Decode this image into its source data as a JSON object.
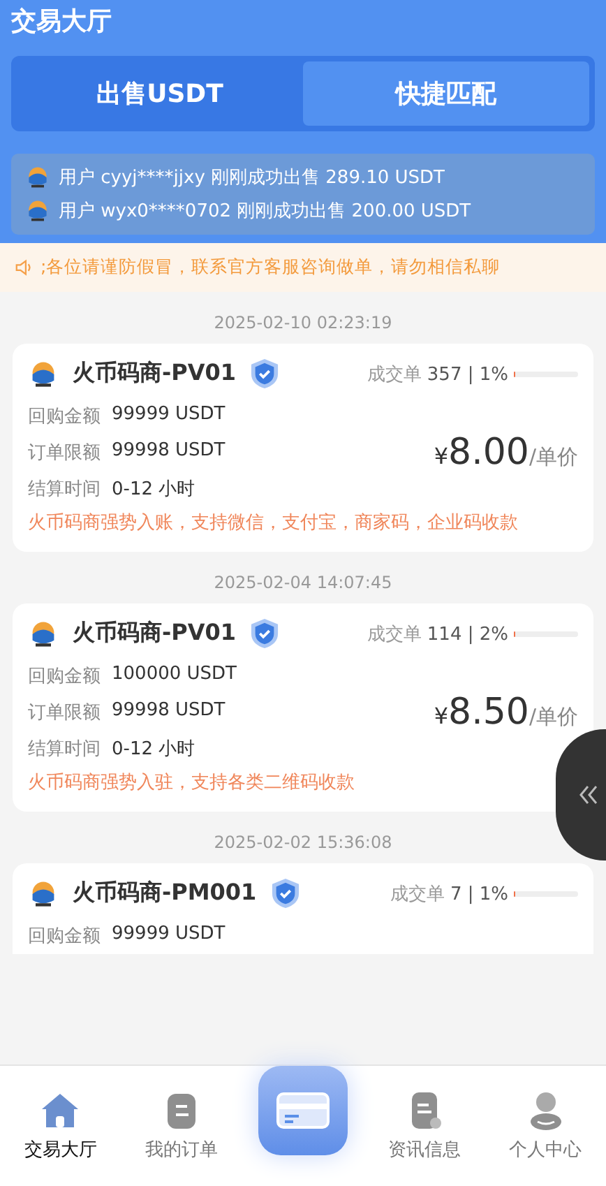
{
  "header": {
    "title": "交易大厅"
  },
  "tabs": [
    {
      "label": "出售USDT",
      "selected": true
    },
    {
      "label": "快捷匹配",
      "selected": false
    }
  ],
  "ticker": [
    "用户 cyyj****jjxy 刚刚成功出售 289.10 USDT",
    "用户 wyx0****0702 刚刚成功出售 200.00 USDT"
  ],
  "notice": ";各位请谨防假冒，联系官方客服咨询做单，请勿相信私聊",
  "listings": [
    {
      "time": "2025-02-10 02:23:19",
      "name": "火币码商-PV01",
      "verified": true,
      "deals_label": "成交单",
      "deals": "357 | 1%",
      "level": 0.01,
      "rows": [
        {
          "label": "回购金额",
          "value": "99999 USDT"
        },
        {
          "label": "订单限额",
          "value": "99998 USDT"
        },
        {
          "label": "结算时间",
          "value": "0-12 小时"
        }
      ],
      "currency": "¥",
      "price": "8.00",
      "unit": "/单价",
      "note": "火币码商强势入账，支持微信，支付宝，商家码，企业码收款"
    },
    {
      "time": "2025-02-04 14:07:45",
      "name": "火币码商-PV01",
      "verified": true,
      "deals_label": "成交单",
      "deals": "114 | 2%",
      "level": 0.02,
      "rows": [
        {
          "label": "回购金额",
          "value": "100000 USDT"
        },
        {
          "label": "订单限额",
          "value": "99998 USDT"
        },
        {
          "label": "结算时间",
          "value": "0-12 小时"
        }
      ],
      "currency": "¥",
      "price": "8.50",
      "unit": "/单价",
      "note": "火币码商强势入驻，支持各类二维码收款"
    },
    {
      "time": "2025-02-02 15:36:08",
      "name": "火币码商-PM001",
      "verified": true,
      "deals_label": "成交单",
      "deals": "7 | 1%",
      "level": 0.01,
      "rows": [
        {
          "label": "回购金额",
          "value": "99999 USDT"
        }
      ]
    }
  ],
  "nav": [
    {
      "kind": "home",
      "label": "交易大厅",
      "selected": true
    },
    {
      "kind": "orders",
      "label": "我的订单",
      "selected": false
    },
    {
      "kind": "center"
    },
    {
      "kind": "news",
      "label": "资讯信息",
      "selected": false
    },
    {
      "kind": "profile",
      "label": "个人中心",
      "selected": false
    }
  ]
}
